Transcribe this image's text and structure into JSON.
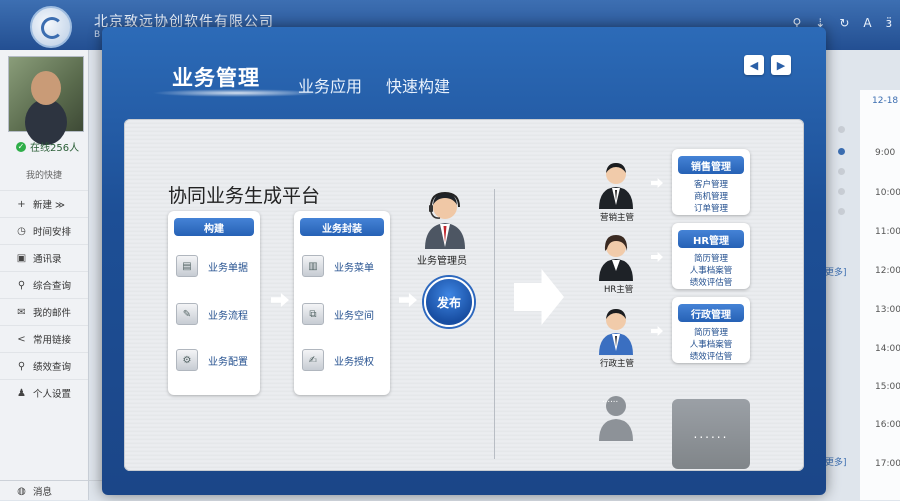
{
  "header": {
    "company": "北京致远协创软件有限公司",
    "company_sub": "B",
    "tools": [
      "⚲",
      "⇣",
      "↻",
      "A",
      "ӟ"
    ]
  },
  "sidebar": {
    "online": "在线256人",
    "quick_title": "我的快捷",
    "items": [
      {
        "icon": "plus-icon",
        "glyph": "+",
        "label": "新建 ≫"
      },
      {
        "icon": "clock-icon",
        "glyph": "◷",
        "label": "时间安排"
      },
      {
        "icon": "contacts-icon",
        "glyph": "▣",
        "label": "通讯录"
      },
      {
        "icon": "search-icon",
        "glyph": "⚲",
        "label": "综合查询"
      },
      {
        "icon": "mail-icon",
        "glyph": "✉",
        "label": "我的邮件"
      },
      {
        "icon": "share-icon",
        "glyph": "<",
        "label": "常用链接"
      },
      {
        "icon": "search-icon",
        "glyph": "⚲",
        "label": "绩效查询"
      },
      {
        "icon": "user-icon",
        "glyph": "♟",
        "label": "个人设置"
      }
    ],
    "message": "消息"
  },
  "calendar": {
    "date": "12-18",
    "times": [
      "9:00",
      "10:00",
      "11:00",
      "12:00",
      "13:00",
      "14:00",
      "15:00",
      "16:00",
      "17:00"
    ],
    "more": "更多]"
  },
  "modal": {
    "tab_main": "业务管理",
    "tabs": [
      "业务应用",
      "快速构建"
    ],
    "prev_glyph": "◀",
    "next_glyph": "▶",
    "platform_title": "协同业务生成平台",
    "build_card": {
      "title": "构建",
      "items": [
        {
          "icon": "form-icon",
          "glyph": "▤",
          "label": "业务单据"
        },
        {
          "icon": "flow-icon",
          "glyph": "✎",
          "label": "业务流程"
        },
        {
          "icon": "gear-icon",
          "glyph": "⚙",
          "label": "业务配置"
        }
      ]
    },
    "package_card": {
      "title": "业务封装",
      "items": [
        {
          "icon": "menu-icon",
          "glyph": "▥",
          "label": "业务菜单"
        },
        {
          "icon": "space-icon",
          "glyph": "⧉",
          "label": "业务空间"
        },
        {
          "icon": "auth-icon",
          "glyph": "✍",
          "label": "业务授权"
        }
      ]
    },
    "admin_label": "业务管理员",
    "publish": "发布",
    "roles": [
      {
        "person": "营销主管",
        "title": "销售管理",
        "items": [
          "客户管理",
          "商机管理",
          "订单管理"
        ]
      },
      {
        "person": "HR主管",
        "title": "HR管理",
        "items": [
          "简历管理",
          "人事档案管",
          "绩效评估管"
        ]
      },
      {
        "person": "行政主管",
        "title": "行政管理",
        "items": [
          "简历管理",
          "人事档案管",
          "绩效评估管"
        ]
      }
    ],
    "placeholder_dots": "......"
  },
  "colors": {
    "accent": "#2661b5",
    "modal_bg": "#1d4f96",
    "top_bar": "#2a5597"
  }
}
